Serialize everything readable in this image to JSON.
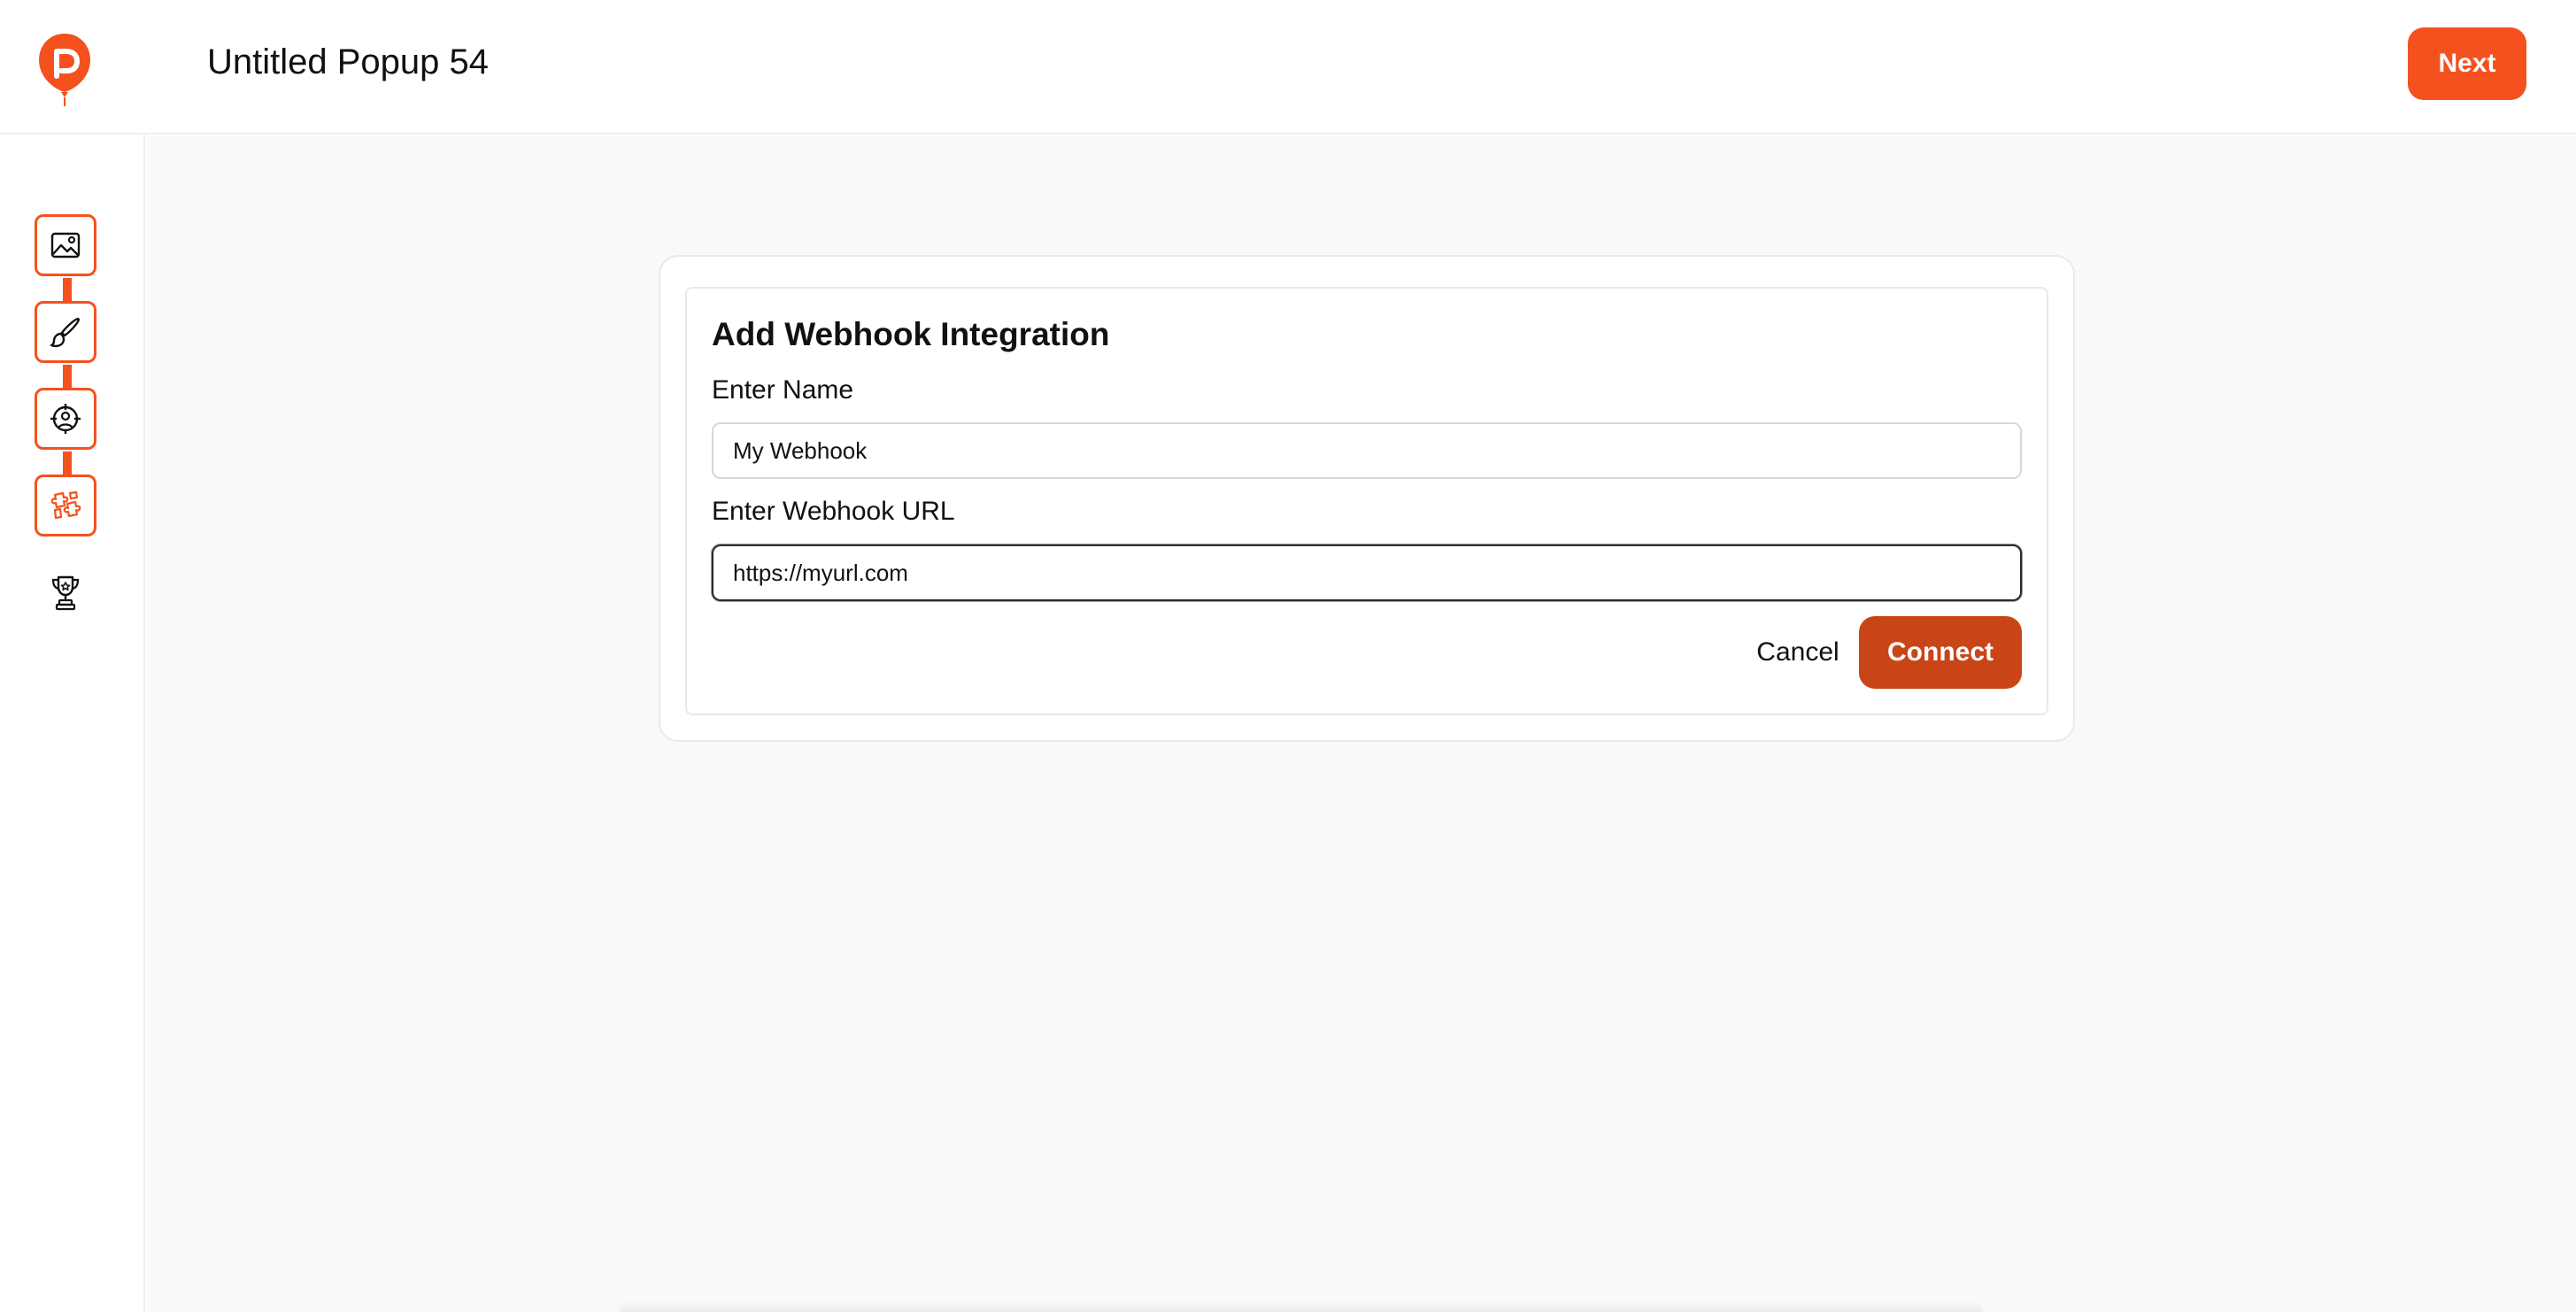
{
  "header": {
    "title": "Untitled Popup 54",
    "next_label": "Next"
  },
  "sidebar": {
    "steps": [
      {
        "name": "image-icon",
        "active": true
      },
      {
        "name": "brush-icon",
        "active": true
      },
      {
        "name": "target-user-icon",
        "active": true
      },
      {
        "name": "integrations-icon",
        "active": true
      },
      {
        "name": "trophy-icon",
        "active": false
      }
    ]
  },
  "dialog": {
    "title": "Add Webhook Integration",
    "name_label": "Enter Name",
    "name_value": "My Webhook",
    "url_label": "Enter Webhook URL",
    "url_value": "https://myurl.com",
    "cancel_label": "Cancel",
    "connect_label": "Connect"
  },
  "colors": {
    "accent": "#f4511e",
    "connect": "#c94518",
    "background": "#f8f9fa"
  }
}
